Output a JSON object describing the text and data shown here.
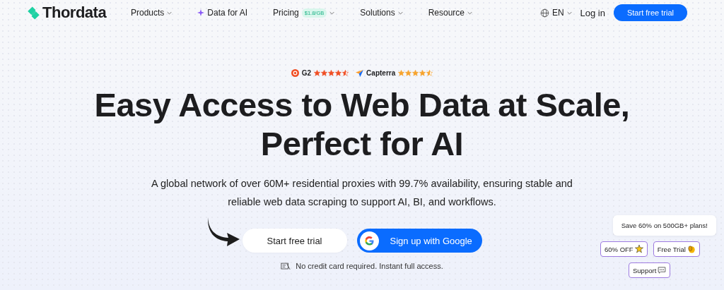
{
  "nav": {
    "brand": "Thordata",
    "items": [
      {
        "label": "Products",
        "kind": "dropdown"
      },
      {
        "label": "Data for AI",
        "kind": "sparkle"
      },
      {
        "label": "Pricing",
        "kind": "dropdown",
        "badge": "$1.8/GB"
      },
      {
        "label": "Solutions",
        "kind": "dropdown"
      },
      {
        "label": "Resource",
        "kind": "dropdown"
      }
    ],
    "language": "EN",
    "login": "Log in",
    "cta": "Start free trial"
  },
  "ratings": [
    {
      "kind": "g2",
      "label": "G2",
      "stars": 4.5
    },
    {
      "kind": "capterra",
      "label": "Capterra",
      "stars": 4.5
    }
  ],
  "hero": {
    "title_lines": [
      "Easy Access to Web Data at Scale,",
      "Perfect for AI"
    ],
    "subtitle": "A global network of over 60M+ residential proxies with 99.7% availability, ensuring stable and reliable web data scraping to support AI, BI, and workflows.",
    "primary_button": "Start free trial",
    "google_button": "Sign up with Google",
    "note": "No credit card required. Instant full access."
  },
  "promo": {
    "message": "Save 60% on 500GB+ plans!",
    "chips": [
      {
        "label": "60% OFF",
        "kind": "star"
      },
      {
        "label": "Free Trial",
        "kind": "clap"
      },
      {
        "label": "Support",
        "kind": "chat"
      }
    ]
  }
}
